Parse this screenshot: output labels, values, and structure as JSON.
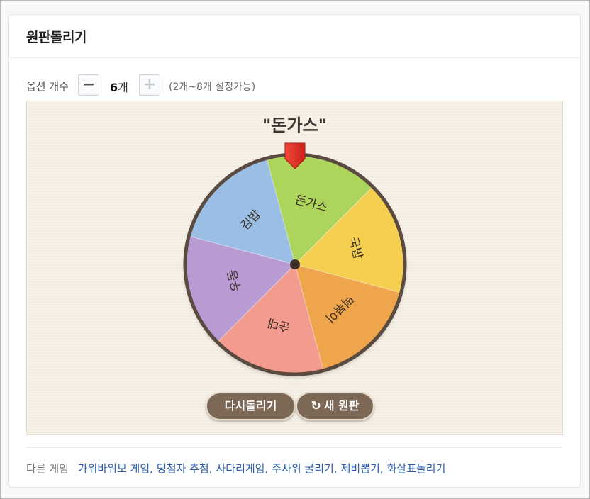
{
  "title": "원판돌리기",
  "options": {
    "label": "옵션 개수",
    "minus": "−",
    "count": "6",
    "unit": "개",
    "plus": "+",
    "range_note": "(2개~8개 설정가능)"
  },
  "result": "\"돈가스\"",
  "wheel": {
    "segments": [
      {
        "label": "돈가스",
        "color": "#add55c"
      },
      {
        "label": "국밥",
        "color": "#f5cf4f"
      },
      {
        "label": "떡볶이",
        "color": "#eea54b"
      },
      {
        "label": "순대",
        "color": "#f39b8e"
      },
      {
        "label": "우동",
        "color": "#b99bd3"
      },
      {
        "label": "김밥",
        "color": "#9bbfe4"
      }
    ],
    "rim_color": "#5a4a3f",
    "pointer_color": "#e5332a"
  },
  "buttons": {
    "retry": "다시돌리기",
    "new_icon": "↻",
    "new": "새 원판"
  },
  "other_games": {
    "label": "다른 게임",
    "links": [
      "가위바위보 게임",
      "당첨자 추첨",
      "사다리게임",
      "주사위 굴리기",
      "제비뽑기",
      "화살표돌리기"
    ]
  }
}
